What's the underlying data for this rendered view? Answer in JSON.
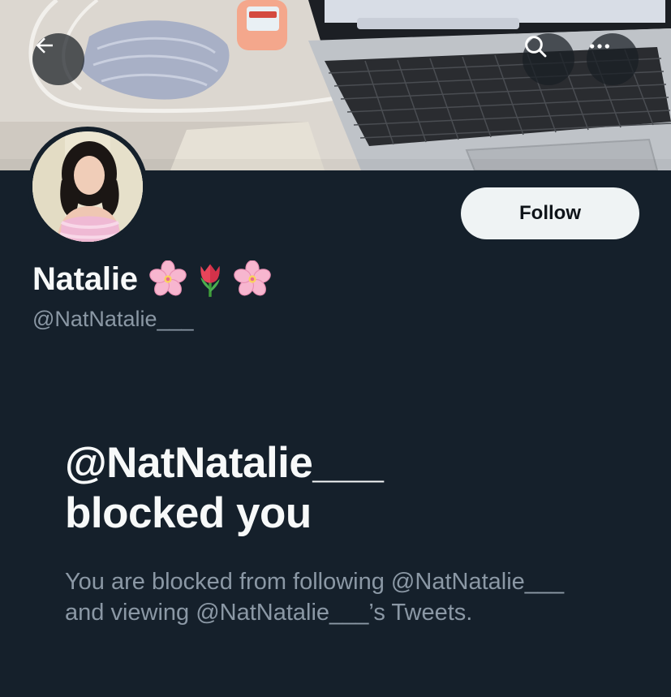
{
  "header": {
    "back_icon": "arrow-left-icon",
    "search_icon": "search-icon",
    "more_icon": "more-horizontal-icon"
  },
  "profile": {
    "display_name": "Natalie",
    "name_emojis": [
      "cherry-blossom",
      "tulip",
      "cherry-blossom"
    ],
    "handle": "@NatNatalie___",
    "follow_label": "Follow"
  },
  "blocked": {
    "title_line1": "@NatNatalie___",
    "title_line2": "blocked you",
    "desc_line1": "You are blocked from following @NatNatalie___",
    "desc_line2": "and viewing @NatNatalie___’s Tweets."
  },
  "theme": {
    "background": "#15202b",
    "primary_text": "#f7f9f9",
    "secondary_text": "#8b98a5",
    "follow_bg": "#eff3f4"
  }
}
